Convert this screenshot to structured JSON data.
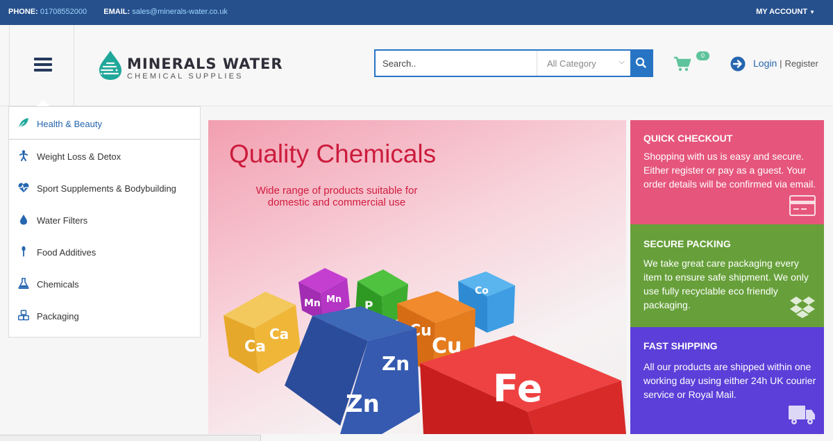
{
  "topbar": {
    "phone_label": "PHONE:",
    "phone": "01708552000",
    "email_label": "EMAIL:",
    "email": "sales@minerals-water.co.uk",
    "account": "MY ACCOUNT"
  },
  "header": {
    "logo_name": "MINERALS WATER",
    "logo_sub": "CHEMICAL SUPPLIES",
    "search_placeholder": "Search..",
    "category_select": "All Category",
    "cart_count": "0",
    "login": "Login",
    "separator": "|",
    "register": "Register"
  },
  "sidebar": {
    "items": [
      {
        "label": "Health & Beauty",
        "icon": "leaf-icon"
      },
      {
        "label": "Weight Loss & Detox",
        "icon": "person-icon"
      },
      {
        "label": "Sport Supplements & Bodybuilding",
        "icon": "heartbeat-icon"
      },
      {
        "label": "Water Filters",
        "icon": "drop-icon"
      },
      {
        "label": "Food Additives",
        "icon": "spoon-icon"
      },
      {
        "label": "Chemicals",
        "icon": "flask-icon"
      },
      {
        "label": "Packaging",
        "icon": "cubes-icon"
      }
    ]
  },
  "banner": {
    "title": "Quality Chemicals",
    "subtitle": "Wide range of products suitable for domestic and commercial use",
    "cubes": [
      "Ca",
      "Mn",
      "P",
      "Cu",
      "Co",
      "Zn",
      "Fe"
    ]
  },
  "features": [
    {
      "heading": "QUICK CHECKOUT",
      "text": "Shopping with us is easy and secure. Either register or pay as a guest. Your order details will be confirmed via email.",
      "icon": "credit-card-icon",
      "color": "#e6567c"
    },
    {
      "heading": "SECURE PACKING",
      "text": "We take great care packaging every item to ensure safe shipment. We only use fully recyclable eco friendly packaging.",
      "icon": "dropbox-icon",
      "color": "#67a03a"
    },
    {
      "heading": "FAST SHIPPING",
      "text": "All our products are shipped within one working day using either 24h UK courier service or Royal Mail.",
      "icon": "truck-icon",
      "color": "#5b3fd8"
    }
  ],
  "colors": {
    "topbar": "#26508c",
    "accent": "#2874c4",
    "brand_teal": "#1fa89a",
    "cart_green": "#5fc39b"
  }
}
